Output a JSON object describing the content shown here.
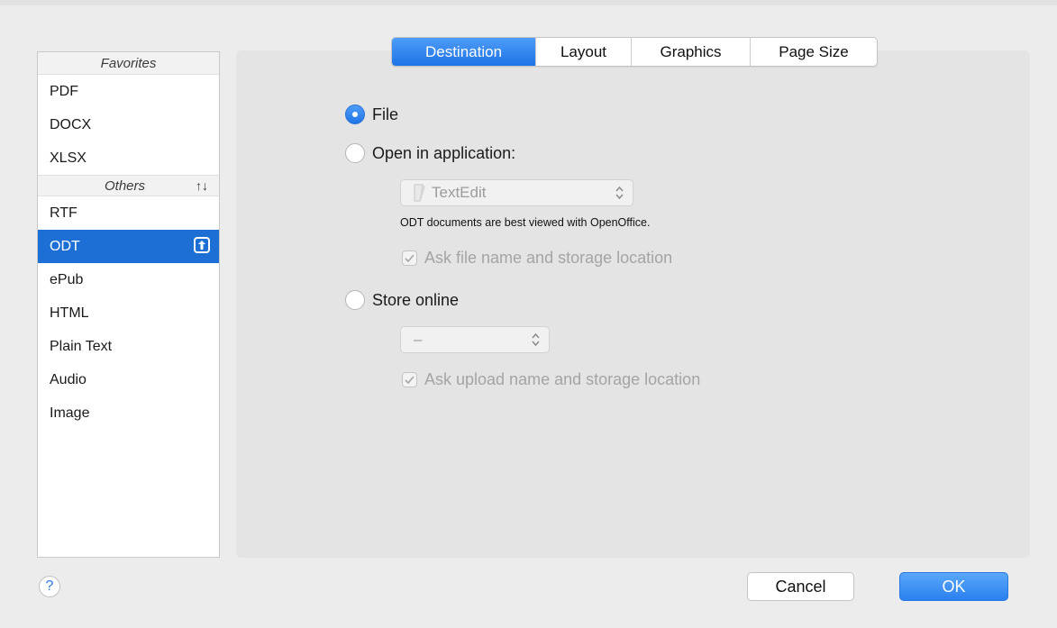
{
  "sidebar": {
    "favorites_header": "Favorites",
    "favorites": [
      {
        "label": "PDF"
      },
      {
        "label": "DOCX"
      },
      {
        "label": "XLSX"
      }
    ],
    "others_header": "Others",
    "others": [
      {
        "label": "RTF"
      },
      {
        "label": "ODT",
        "selected": true
      },
      {
        "label": "ePub"
      },
      {
        "label": "HTML"
      },
      {
        "label": "Plain Text"
      },
      {
        "label": "Audio"
      },
      {
        "label": "Image"
      }
    ],
    "icons": {
      "sort": "sort-arrows-icon",
      "move_to_favorites": "upload-arrow-icon"
    }
  },
  "tabs": [
    {
      "label": "Destination",
      "active": true
    },
    {
      "label": "Layout"
    },
    {
      "label": "Graphics"
    },
    {
      "label": "Page Size"
    }
  ],
  "destination": {
    "file_label": "File",
    "open_in_app_label": "Open in application:",
    "app_popup_value": "TextEdit",
    "app_note": "ODT documents are best viewed with OpenOffice.",
    "ask_file_label": "Ask file name and storage location",
    "store_online_label": "Store online",
    "online_popup_value": "–",
    "ask_upload_label": "Ask upload name and storage location",
    "selected": "file",
    "ask_file_checked": true,
    "ask_upload_checked": true
  },
  "footer": {
    "help_label": "?",
    "cancel_label": "Cancel",
    "ok_label": "OK"
  },
  "colors": {
    "accent": "#1d6fd6",
    "panel": "#e4e4e4",
    "window": "#ececec"
  }
}
